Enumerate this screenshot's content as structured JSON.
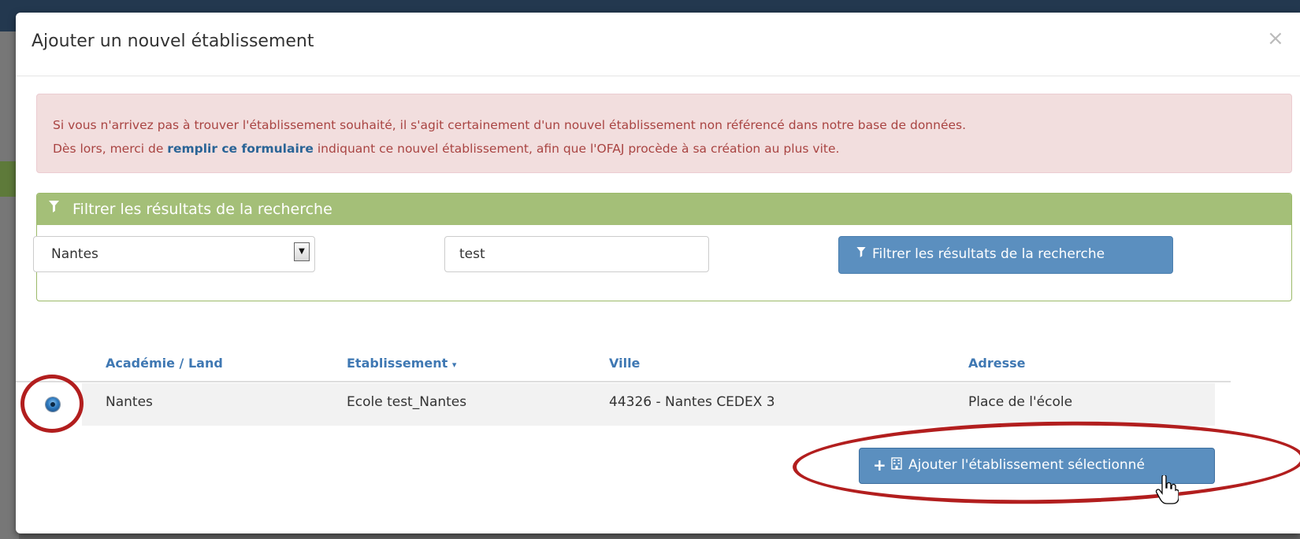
{
  "modal": {
    "title": "Ajouter un nouvel établissement",
    "close": "×"
  },
  "alert": {
    "line1": "Si vous n'arrivez pas à trouver l'établissement souhaité, il s'agit certainement d'un nouvel établissement non référencé dans notre base de données.",
    "line2_prefix": "Dès lors, merci de ",
    "line2_link": "remplir ce formulaire",
    "line2_suffix": " indiquant ce nouvel établissement, afin que l'OFAJ procède à sa création au plus vite."
  },
  "filter": {
    "heading": "Filtrer les résultats de la recherche",
    "heading_icon": "filter-icon",
    "select_value": "Nantes",
    "search_value": "test",
    "button_label": "Filtrer les résultats de la recherche",
    "button_icon": "filter-icon"
  },
  "table": {
    "columns": [
      "Académie / Land",
      "Etablissement",
      "Ville",
      "Adresse"
    ],
    "sort_indicator": "⌄",
    "rows": [
      {
        "selected": true,
        "academie": "Nantes",
        "etablissement": "Ecole test_Nantes",
        "ville": "44326 - Nantes CEDEX 3",
        "adresse": "Place de l'école"
      }
    ]
  },
  "add_button": {
    "label": "Ajouter l'établissement sélectionné",
    "icons": [
      "plus-icon",
      "building-icon"
    ]
  },
  "colors": {
    "primary_button": "#5b8fbf",
    "panel_heading": "#a4bf78",
    "alert_bg": "#f2dede",
    "alert_text": "#a94442",
    "highlight_ring": "#b21e1e",
    "link": "#3f78b3"
  }
}
